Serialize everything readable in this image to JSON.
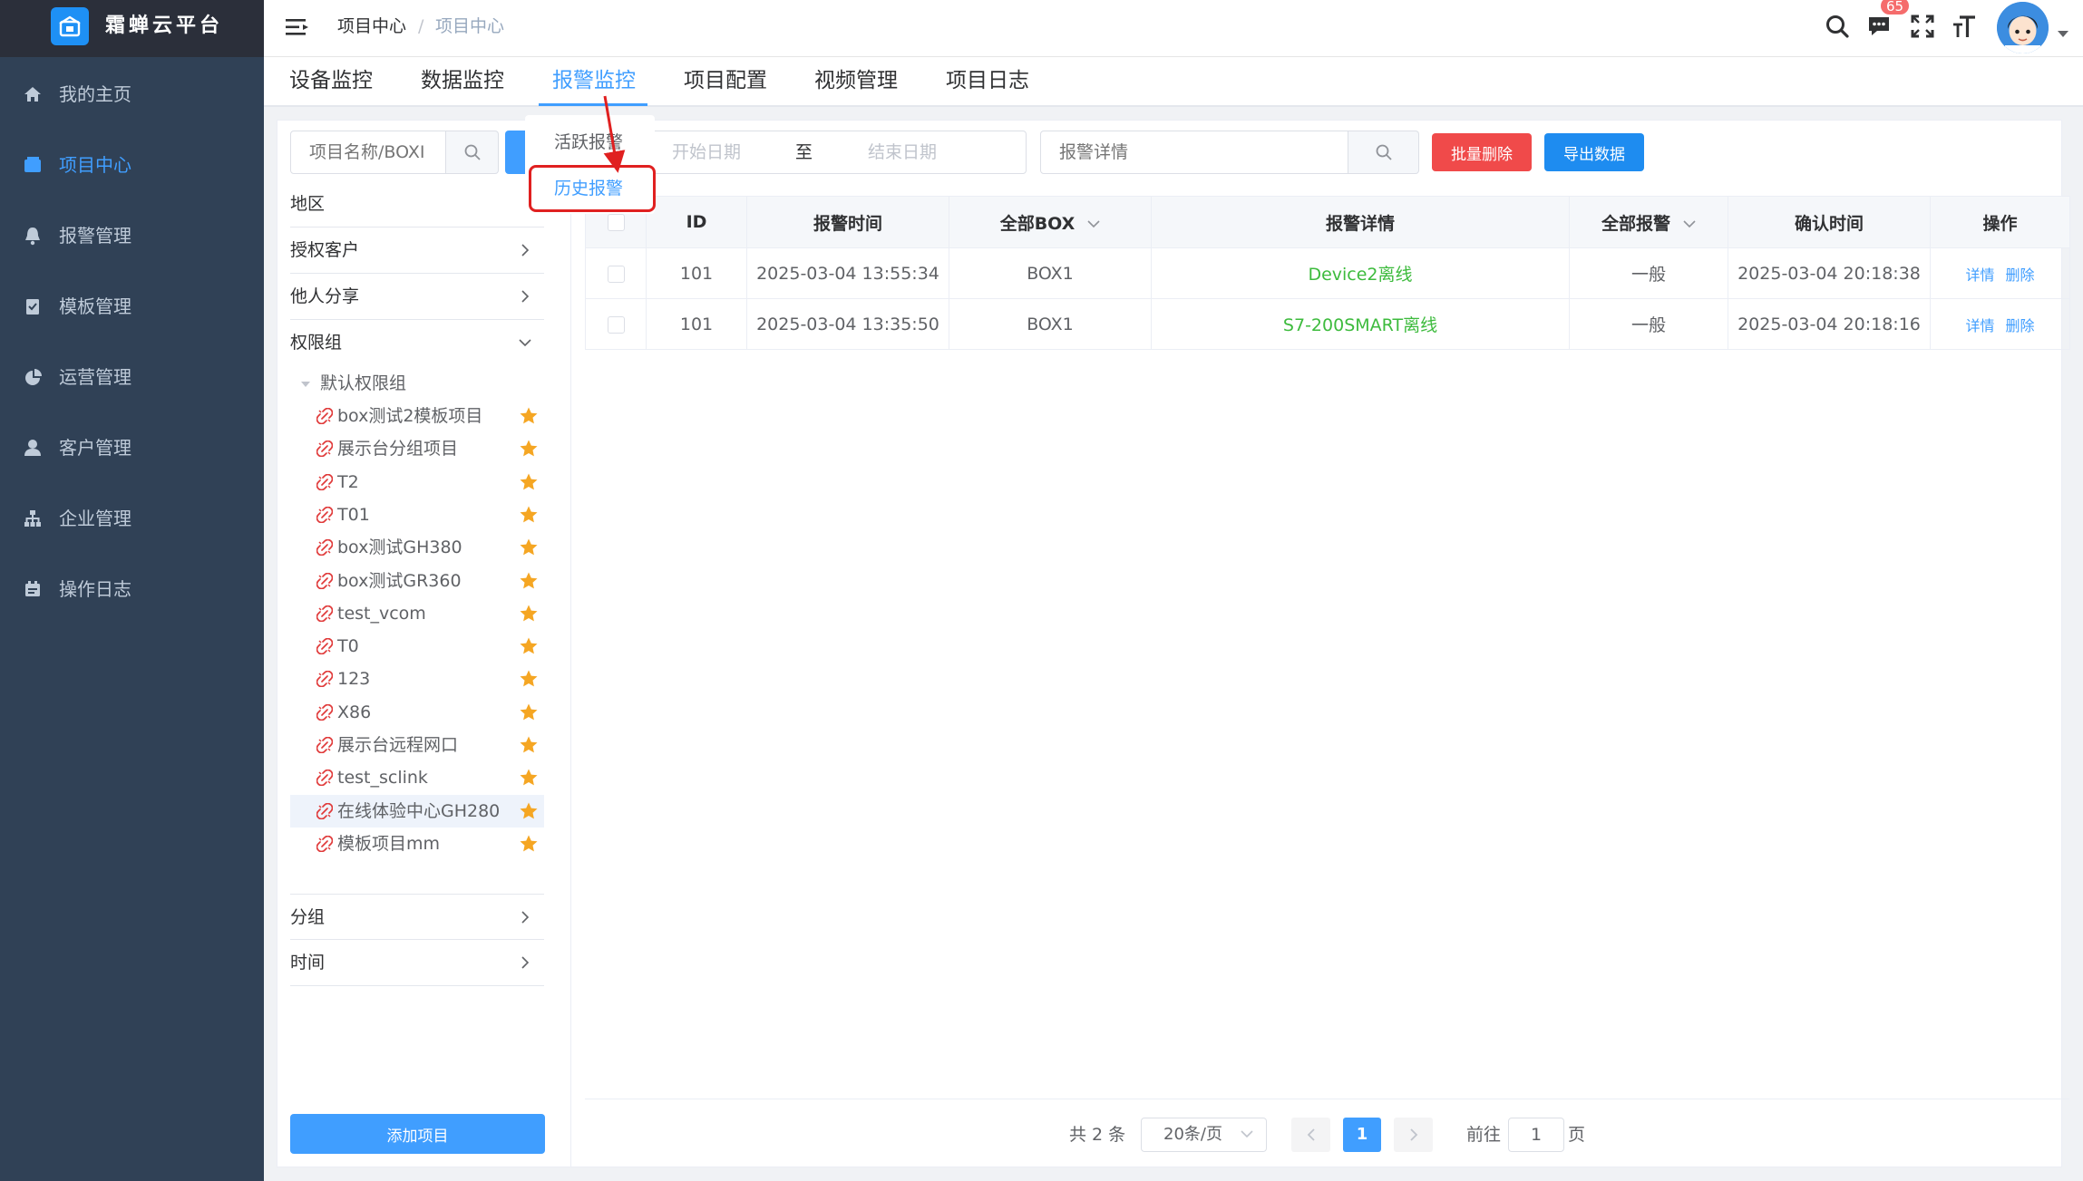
{
  "app": {
    "name": "霜蝉云平台"
  },
  "sidebar": {
    "items": [
      {
        "label": "我的主页",
        "icon": "home-icon"
      },
      {
        "label": "项目中心",
        "icon": "folder-icon"
      },
      {
        "label": "报警管理",
        "icon": "bell-icon"
      },
      {
        "label": "模板管理",
        "icon": "clipboard-icon"
      },
      {
        "label": "运营管理",
        "icon": "pie-chart-icon"
      },
      {
        "label": "客户管理",
        "icon": "user-icon"
      },
      {
        "label": "企业管理",
        "icon": "org-icon"
      },
      {
        "label": "操作日志",
        "icon": "log-icon"
      }
    ],
    "active": "项目中心"
  },
  "header": {
    "breadcrumb": [
      "项目中心",
      "/",
      "项目中心"
    ],
    "message_badge": "65",
    "icons": [
      "search-icon",
      "message-icon",
      "fullscreen-icon",
      "font-size-icon"
    ]
  },
  "tabs": [
    {
      "label": "设备监控"
    },
    {
      "label": "数据监控"
    },
    {
      "label": "报警监控"
    },
    {
      "label": "项目配置"
    },
    {
      "label": "视频管理"
    },
    {
      "label": "项目日志"
    }
  ],
  "active_tab": "报警监控",
  "dropdown": {
    "items": [
      "活跃报警",
      "历史报警"
    ],
    "highlighted": "历史报警"
  },
  "left_panel": {
    "search_placeholder": "项目名称/BOXI",
    "filters": [
      {
        "label": "地区"
      },
      {
        "label": "授权客户"
      },
      {
        "label": "他人分享"
      },
      {
        "label": "权限组"
      }
    ],
    "tree_root": "默认权限组",
    "projects": [
      "box测试2模板项目",
      "展示台分组项目",
      "T2",
      "T01",
      "box测试GH380",
      "box测试GR360",
      "test_vcom",
      "T0",
      "123",
      "X86",
      "展示台远程网口",
      "test_sclink",
      "在线体验中心GH280",
      "模板项目mm"
    ],
    "selected_project": "在线体验中心GH280",
    "bottom_filters": [
      {
        "label": "分组"
      },
      {
        "label": "时间"
      }
    ],
    "add_button": "添加项目"
  },
  "toolbar": {
    "date_start_placeholder": "开始日期",
    "date_to": "至",
    "date_end_placeholder": "结束日期",
    "detail_placeholder": "报警详情",
    "batch_delete": "批量删除",
    "export": "导出数据"
  },
  "table": {
    "columns": [
      "ID",
      "报警时间",
      "全部BOX",
      "报警详情",
      "全部报警",
      "确认时间",
      "操作"
    ],
    "rows": [
      {
        "id": "101",
        "time": "2025-03-04 13:55:34",
        "box": "BOX1",
        "detail": "Device2离线",
        "level": "一般",
        "confirm": "2025-03-04 20:18:38",
        "op_detail": "详情",
        "op_delete": "删除"
      },
      {
        "id": "101",
        "time": "2025-03-04 13:35:50",
        "box": "BOX1",
        "detail": "S7-200SMART离线",
        "level": "一般",
        "confirm": "2025-03-04 20:18:16",
        "op_detail": "详情",
        "op_delete": "删除"
      }
    ]
  },
  "pagination": {
    "total": "共 2 条",
    "page_size": "20条/页",
    "current": "1",
    "goto_label": "前往",
    "goto_value": "1",
    "page_label": "页"
  },
  "colors": {
    "accent": "#409eff",
    "sidebar": "#304156",
    "danger": "#f04a4a",
    "success_text": "#3dbb3d",
    "star": "#f5a623",
    "link_icon": "#e03a3a"
  }
}
